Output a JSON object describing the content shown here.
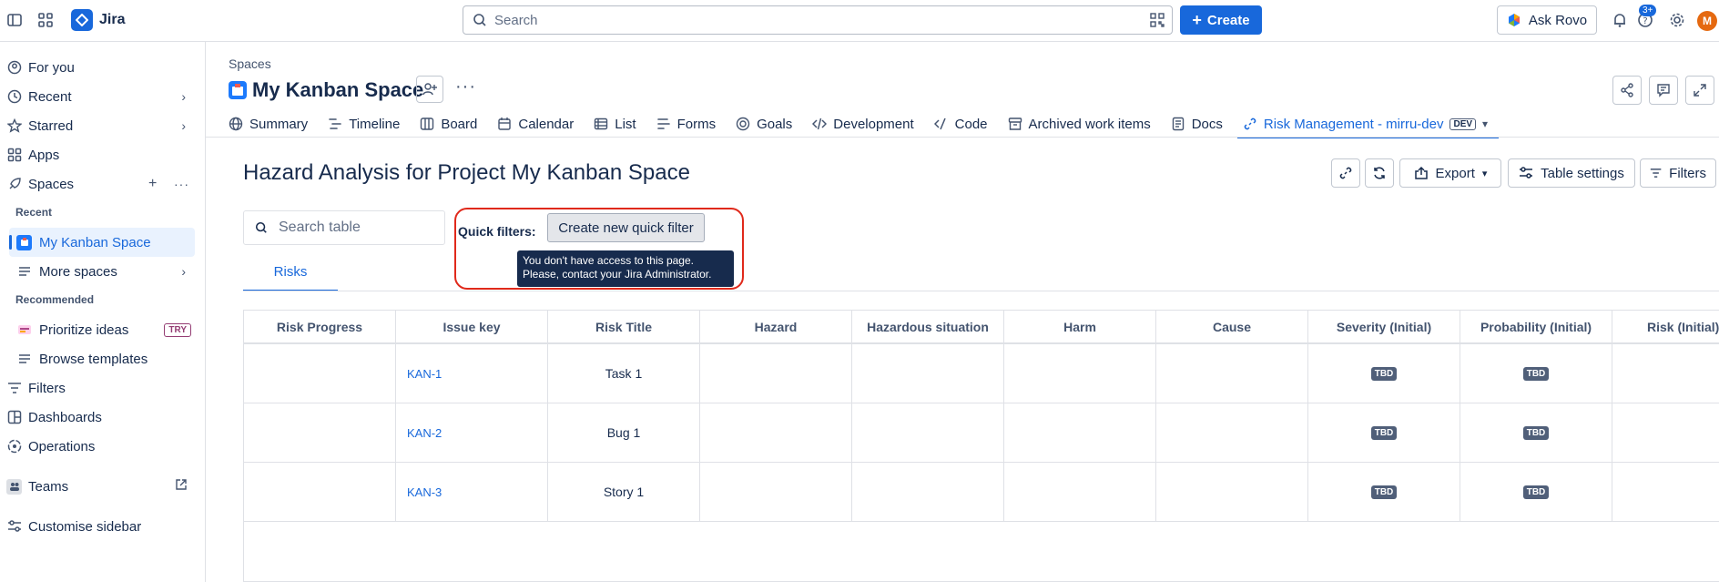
{
  "topbar": {
    "app_name": "Jira",
    "search_placeholder": "Search",
    "create_label": "Create",
    "ask_rovo_label": "Ask Rovo",
    "help_badge": "3+",
    "avatar_initial": "M"
  },
  "sidebar": {
    "items": {
      "for_you": "For you",
      "recent": "Recent",
      "starred": "Starred",
      "apps": "Apps",
      "spaces": "Spaces",
      "recent_head": "Recent",
      "my_kanban": "My Kanban Space",
      "more_spaces": "More spaces",
      "recommended_head": "Recommended",
      "prioritize_ideas": "Prioritize ideas",
      "try_badge": "TRY",
      "browse_templates": "Browse templates",
      "filters": "Filters",
      "dashboards": "Dashboards",
      "operations": "Operations",
      "teams": "Teams",
      "customise": "Customise sidebar"
    }
  },
  "main": {
    "breadcrumb": "Spaces",
    "space_title": "My Kanban Space",
    "tabs": [
      {
        "label": "Summary",
        "icon": "globe-icon"
      },
      {
        "label": "Timeline",
        "icon": "timeline-icon"
      },
      {
        "label": "Board",
        "icon": "board-icon"
      },
      {
        "label": "Calendar",
        "icon": "calendar-icon"
      },
      {
        "label": "List",
        "icon": "list-icon"
      },
      {
        "label": "Forms",
        "icon": "forms-icon"
      },
      {
        "label": "Goals",
        "icon": "goals-icon"
      },
      {
        "label": "Development",
        "icon": "development-icon"
      },
      {
        "label": "Code",
        "icon": "code-icon"
      },
      {
        "label": "Archived work items",
        "icon": "archive-icon"
      },
      {
        "label": "Docs",
        "icon": "docs-icon"
      },
      {
        "label": "Risk Management - mirru-dev",
        "icon": "link-icon",
        "badge": "DEV"
      }
    ],
    "page_title": "Hazard Analysis for Project My Kanban Space",
    "actions": {
      "export": "Export",
      "table_settings": "Table settings",
      "filters": "Filters"
    },
    "table_search_placeholder": "Search table",
    "quick_filters_label": "Quick filters:",
    "create_quick_filter": "Create new quick filter",
    "tooltip_line1": "You don't have access to this page.",
    "tooltip_line2": "Please, contact your Jira Administrator.",
    "risks_tab": "Risks"
  },
  "table": {
    "headers": [
      "Risk Progress",
      "Issue key",
      "Risk Title",
      "Hazard",
      "Hazardous situation",
      "Harm",
      "Cause",
      "Severity (Initial)",
      "Probability (Initial)",
      "Risk (Initial)"
    ],
    "rows": [
      {
        "key": "KAN-1",
        "title": "Task 1",
        "severity": "TBD",
        "probability": "TBD"
      },
      {
        "key": "KAN-2",
        "title": "Bug 1",
        "severity": "TBD",
        "probability": "TBD"
      },
      {
        "key": "KAN-3",
        "title": "Story 1",
        "severity": "TBD",
        "probability": "TBD"
      }
    ]
  },
  "colors": {
    "brand": "#1868db",
    "highlight": "#e0291b",
    "tooltip_bg": "#172b4d"
  }
}
